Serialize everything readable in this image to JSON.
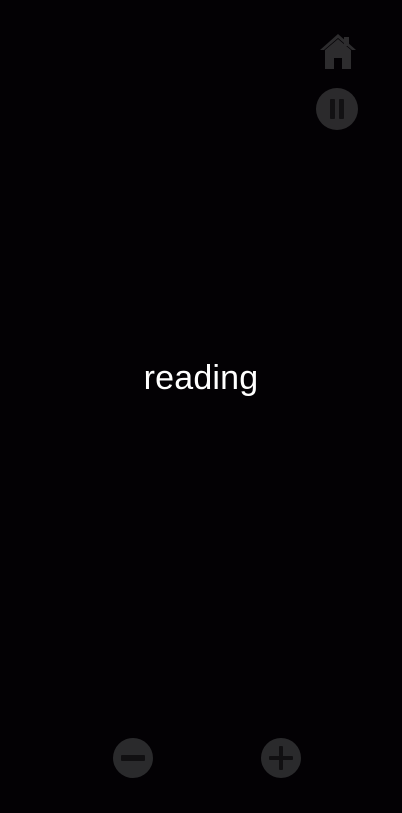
{
  "reader": {
    "current_word": "reading"
  },
  "controls": {
    "home_icon": "home-icon",
    "pause_icon": "pause-icon",
    "decrease_icon": "minus-icon",
    "increase_icon": "plus-icon"
  },
  "colors": {
    "background": "#030104",
    "text": "#ffffff",
    "control": "#2b2a2c",
    "control_glyph": "#111012"
  }
}
